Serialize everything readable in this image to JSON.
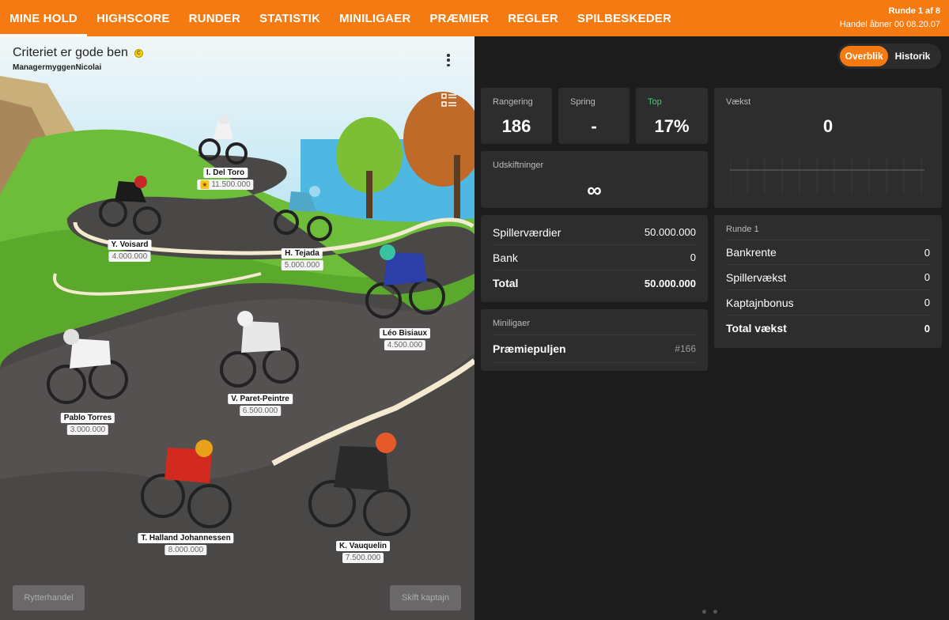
{
  "nav": {
    "items": [
      "MINE HOLD",
      "HIGHSCORE",
      "RUNDER",
      "STATISTIK",
      "MINILIGAER",
      "PRÆMIER",
      "REGLER",
      "SPILBESKEDER"
    ],
    "round": "Runde 1 af 8",
    "trade_opens": "Handel åbner 00 08.20.07"
  },
  "team": {
    "name": "Criteriet er gode ben",
    "coin_label": "C",
    "manager": "ManagermyggenNicolai"
  },
  "riders": [
    {
      "name": "I. Del Toro",
      "price": "11.500.000",
      "captain": true
    },
    {
      "name": "Y. Voisard",
      "price": "4.000.000"
    },
    {
      "name": "H. Tejada",
      "price": "5.000.000"
    },
    {
      "name": "Léo Bisiaux",
      "price": "4.500.000"
    },
    {
      "name": "Pablo Torres",
      "price": "3.000.000"
    },
    {
      "name": "V. Paret-Peintre",
      "price": "6.500.000"
    },
    {
      "name": "T. Halland Johannessen",
      "price": "8.000.000"
    },
    {
      "name": "K. Vauquelin",
      "price": "7.500.000"
    }
  ],
  "actions": {
    "trade": "Rytterhandel",
    "captain": "Skift kaptajn"
  },
  "tabs": {
    "overview": "Overblik",
    "history": "Historik"
  },
  "stats": {
    "ranking": {
      "label": "Rangering",
      "value": "186"
    },
    "jump": {
      "label": "Spring",
      "value": "-"
    },
    "top": {
      "label": "Top",
      "value": "17%"
    },
    "growth": {
      "label": "Vækst",
      "value": "0"
    },
    "substitutions": {
      "label": "Udskiftninger",
      "value": "∞"
    }
  },
  "finance": {
    "rows": [
      {
        "label": "Spillerværdier",
        "value": "50.000.000"
      },
      {
        "label": "Bank",
        "value": "0"
      },
      {
        "label": "Total",
        "value": "50.000.000"
      }
    ]
  },
  "round_card": {
    "title": "Runde 1",
    "rows": [
      {
        "label": "Bankrente",
        "value": "0"
      },
      {
        "label": "Spillervækst",
        "value": "0"
      },
      {
        "label": "Kaptajnbonus",
        "value": "0"
      },
      {
        "label": "Total vækst",
        "value": "0"
      }
    ]
  },
  "minileagues": {
    "title": "Miniligaer",
    "items": [
      {
        "name": "Præmiepuljen",
        "rank": "#166"
      }
    ]
  },
  "colors": {
    "accent": "#f47a11",
    "positive": "#3ecf6a",
    "panel": "#2d2d2d"
  }
}
